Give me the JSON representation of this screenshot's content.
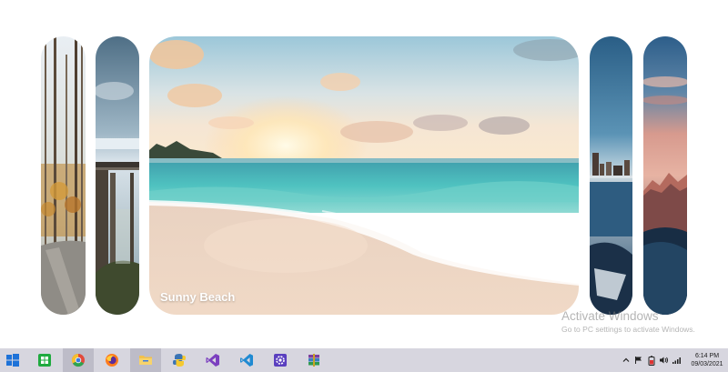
{
  "gallery": {
    "panels": [
      {
        "id": "forest",
        "label": ""
      },
      {
        "id": "bridge",
        "label": ""
      },
      {
        "id": "beach",
        "label": "Sunny Beach"
      },
      {
        "id": "city",
        "label": ""
      },
      {
        "id": "mountain",
        "label": ""
      }
    ]
  },
  "watermark": {
    "title": "Activate Windows",
    "subtitle": "Go to PC settings to activate Windows."
  },
  "taskbar": {
    "apps": [
      {
        "icon": "windows-start-icon",
        "color": "#1e72d8"
      },
      {
        "icon": "spreadsheet-icon",
        "color": "#1faa3f"
      },
      {
        "icon": "chrome-icon",
        "color": "#e24a3b"
      },
      {
        "icon": "firefox-icon",
        "color": "#ff7b1c"
      },
      {
        "icon": "file-explorer-icon",
        "color": "#f2c14b"
      },
      {
        "icon": "python-icon",
        "color": "#3b74b5"
      },
      {
        "icon": "visual-studio-icon",
        "color": "#7b3fbf"
      },
      {
        "icon": "vscode-icon",
        "color": "#1f8ad2"
      },
      {
        "icon": "settings-icon",
        "color": "#5a3fbf"
      },
      {
        "icon": "archive-icon",
        "color": "#7a3fa0"
      }
    ],
    "tray": {
      "icons": [
        "chevron-up-icon",
        "flag-icon",
        "battery-icon",
        "volume-icon",
        "network-icon"
      ],
      "time": "6:14 PM",
      "date": "09/03/2021"
    }
  }
}
